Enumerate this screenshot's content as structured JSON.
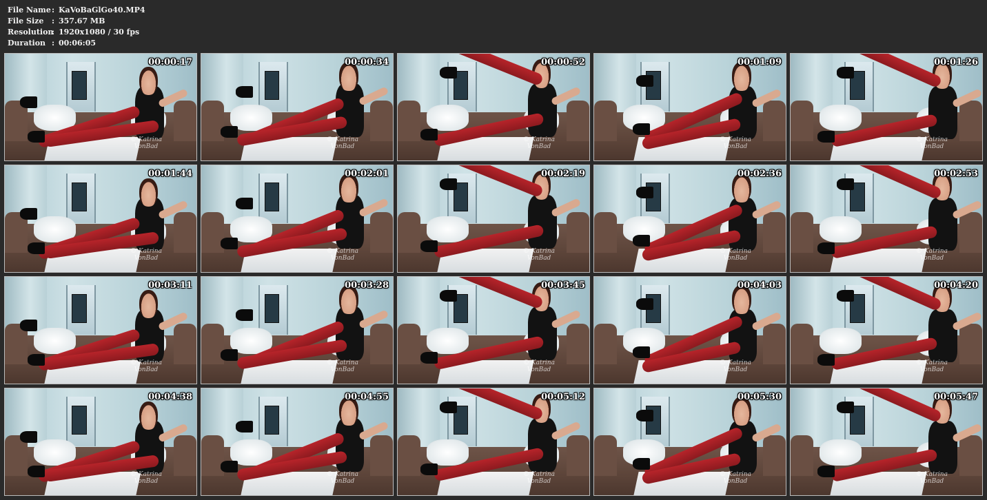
{
  "header": {
    "file_name_label": "File Name",
    "file_name": "KaVoBaGlGo40.MP4",
    "file_size_label": "File Size",
    "file_size": "357.67 MB",
    "resolution_label": "Resolution",
    "resolution": "1920x1080 / 30 fps",
    "duration_label": "Duration",
    "duration": "00:06:05",
    "separator": ":"
  },
  "watermark": {
    "line1": "© Katrina",
    "line2": "VonBad"
  },
  "thumbnails": [
    {
      "timestamp": "00:00:17"
    },
    {
      "timestamp": "00:00:34"
    },
    {
      "timestamp": "00:00:52"
    },
    {
      "timestamp": "00:01:09"
    },
    {
      "timestamp": "00:01:26"
    },
    {
      "timestamp": "00:01:44"
    },
    {
      "timestamp": "00:02:01"
    },
    {
      "timestamp": "00:02:19"
    },
    {
      "timestamp": "00:02:36"
    },
    {
      "timestamp": "00:02:53"
    },
    {
      "timestamp": "00:03:11"
    },
    {
      "timestamp": "00:03:28"
    },
    {
      "timestamp": "00:03:45"
    },
    {
      "timestamp": "00:04:03"
    },
    {
      "timestamp": "00:04:20"
    },
    {
      "timestamp": "00:04:38"
    },
    {
      "timestamp": "00:04:55"
    },
    {
      "timestamp": "00:05:12"
    },
    {
      "timestamp": "00:05:30"
    },
    {
      "timestamp": "00:05:47"
    }
  ]
}
